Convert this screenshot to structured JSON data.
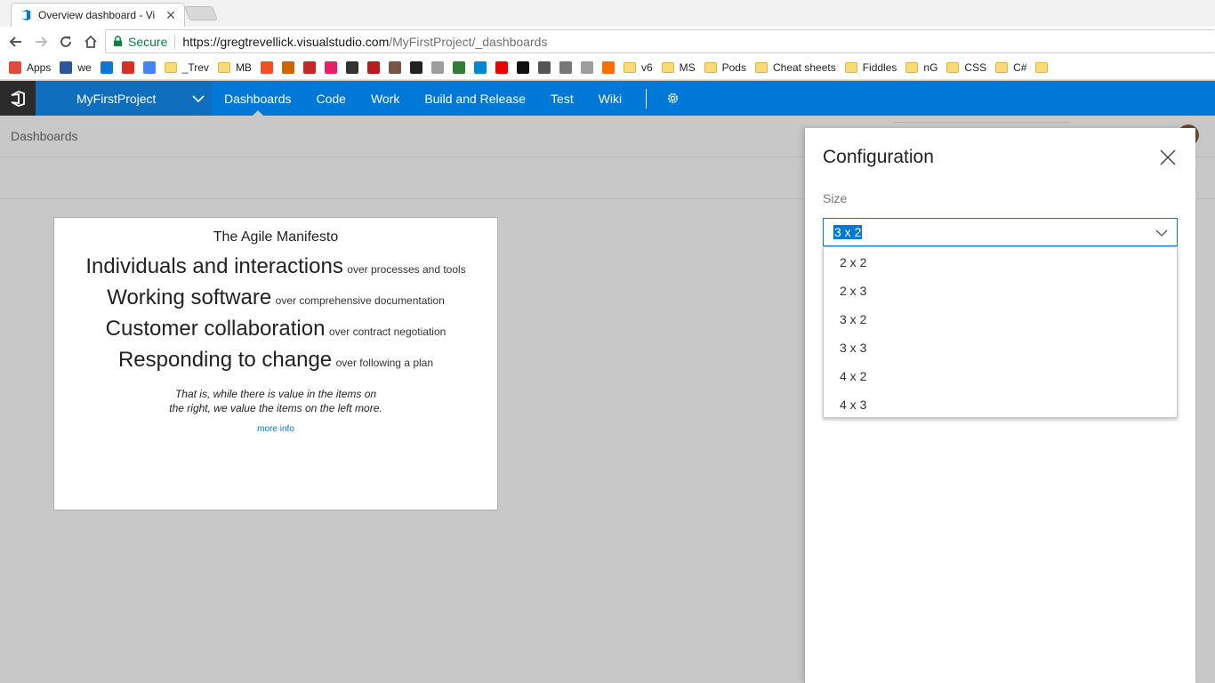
{
  "browser": {
    "tab_title": "Overview dashboard - Vi",
    "tab_close": "✕",
    "url_secure": "Secure",
    "url_host": "https://gregtrevellick.visualstudio.com",
    "url_path": "/MyFirstProject/_dashboards",
    "bookmarks": [
      {
        "label": "Apps",
        "icon": "apps-grid-icon",
        "color": "#e04a3f"
      },
      {
        "label": "we",
        "icon": "word-icon",
        "color": "#2b579a"
      },
      {
        "label": "",
        "icon": "onedrive-icon",
        "color": "#0f78d4"
      },
      {
        "label": "",
        "icon": "gmail-icon",
        "color": "#d93025"
      },
      {
        "label": "",
        "icon": "calendar-icon",
        "color": "#4285f4"
      },
      {
        "label": "_Trev",
        "icon": "folder-icon",
        "color": "#fbd977"
      },
      {
        "label": "MB",
        "icon": "folder-icon",
        "color": "#fbd977"
      },
      {
        "label": "",
        "icon": "microsoft-icon",
        "color": "#f25022"
      },
      {
        "label": "",
        "icon": "tools-icon",
        "color": "#cc6600"
      },
      {
        "label": "",
        "icon": "red-icon",
        "color": "#c62828"
      },
      {
        "label": "",
        "icon": "music-icon",
        "color": "#e91e63"
      },
      {
        "label": "",
        "icon": "dark-icon",
        "color": "#333333"
      },
      {
        "label": "",
        "icon": "tv-icon",
        "color": "#b71c1c"
      },
      {
        "label": "",
        "icon": "goodreads-icon",
        "color": "#795548"
      },
      {
        "label": "",
        "icon": "news-icon",
        "color": "#222222"
      },
      {
        "label": "",
        "icon": "page-icon",
        "color": "#9e9e9e"
      },
      {
        "label": "",
        "icon": "rn-icon",
        "color": "#2e7d32"
      },
      {
        "label": "",
        "icon": "blue-icon",
        "color": "#0288d1"
      },
      {
        "label": "",
        "icon": "santander-icon",
        "color": "#ec0000"
      },
      {
        "label": "",
        "icon": "sky-icon",
        "color": "#111111"
      },
      {
        "label": "",
        "icon": "hand-icon",
        "color": "#555555"
      },
      {
        "label": "",
        "icon": "face-icon",
        "color": "#777777"
      },
      {
        "label": "",
        "icon": "page-icon",
        "color": "#9e9e9e"
      },
      {
        "label": "",
        "icon": "orange-icon",
        "color": "#ff6f00"
      },
      {
        "label": "v6",
        "icon": "folder-icon",
        "color": "#fbd977"
      },
      {
        "label": "MS",
        "icon": "folder-icon",
        "color": "#fbd977"
      },
      {
        "label": "Pods",
        "icon": "folder-icon",
        "color": "#fbd977"
      },
      {
        "label": "Cheat sheets",
        "icon": "folder-icon",
        "color": "#fbd977"
      },
      {
        "label": "Fiddles",
        "icon": "folder-icon",
        "color": "#fbd977"
      },
      {
        "label": "nG",
        "icon": "folder-icon",
        "color": "#fbd977"
      },
      {
        "label": "CSS",
        "icon": "folder-icon",
        "color": "#fbd977"
      },
      {
        "label": "C#",
        "icon": "folder-icon",
        "color": "#fbd977"
      },
      {
        "label": "",
        "icon": "folder-icon",
        "color": "#fbd977"
      }
    ]
  },
  "header": {
    "project": "MyFirstProject",
    "nav": [
      "Dashboards",
      "Code",
      "Work",
      "Build and Release",
      "Test",
      "Wiki"
    ],
    "active_nav": "Dashboards",
    "brand_color": "#0078d7"
  },
  "breadcrumb": "Dashboards",
  "widget": {
    "title": "The Agile Manifesto",
    "values": [
      {
        "big": "Individuals and interactions",
        "small": "over processes and tools"
      },
      {
        "big": "Working software",
        "small": "over comprehensive documentation"
      },
      {
        "big": "Customer collaboration",
        "small": "over contract negotiation"
      },
      {
        "big": "Responding to change",
        "small": "over following a plan"
      }
    ],
    "quote_line1": "That is, while there is value in the items on",
    "quote_line2": "the right, we value the items on the left more.",
    "more_info": "more info"
  },
  "config": {
    "title": "Configuration",
    "size_label": "Size",
    "selected": "3 x 2",
    "options": [
      "2 x 2",
      "2 x 3",
      "3 x 2",
      "3 x 3",
      "4 x 2",
      "4 x 3"
    ]
  }
}
